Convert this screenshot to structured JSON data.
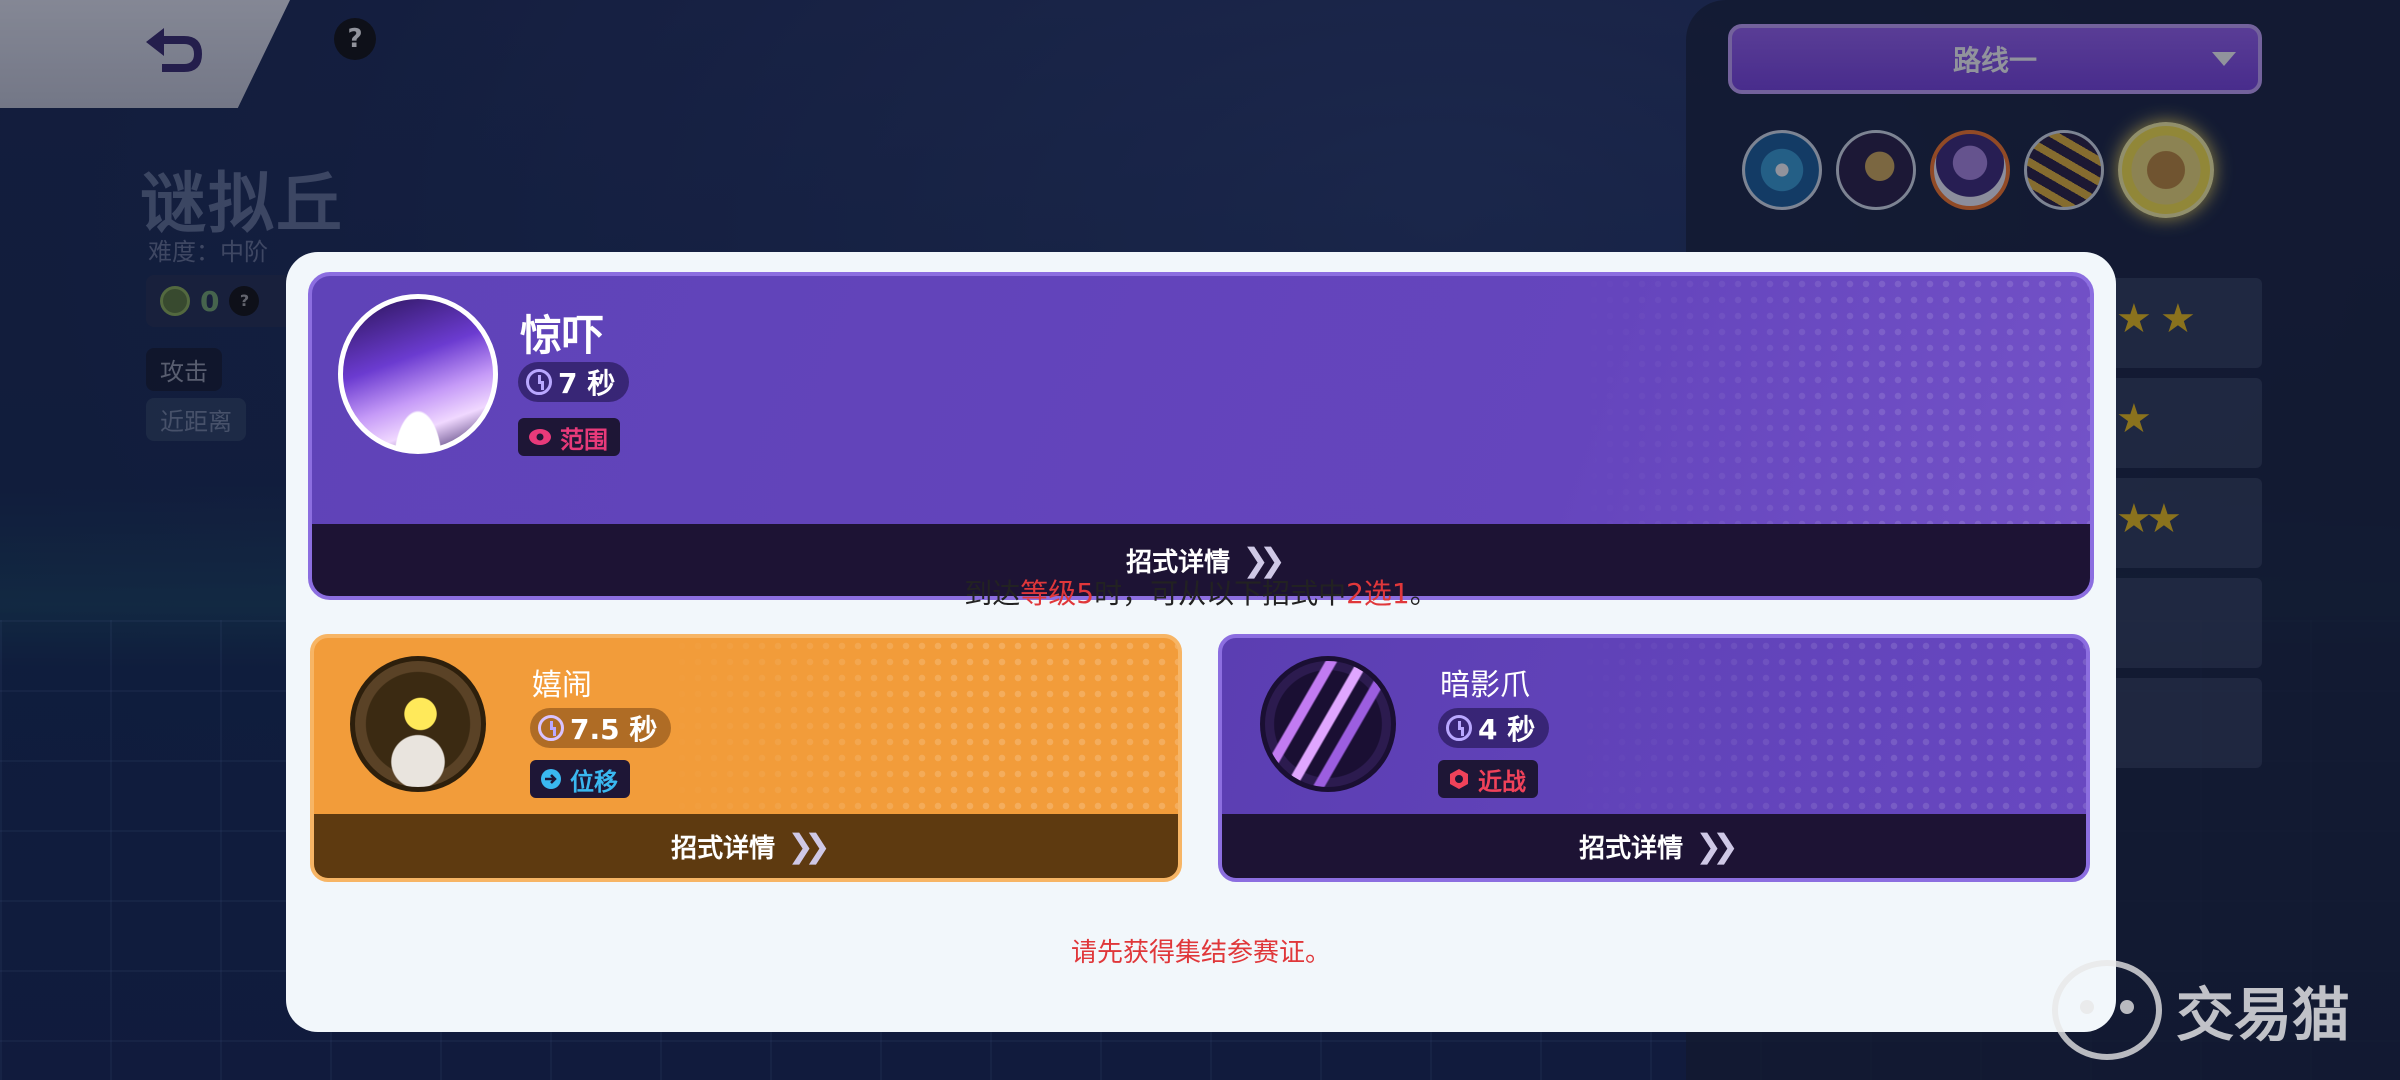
{
  "background": {
    "stage_title": "谜拟丘",
    "difficulty": "难度：中阶",
    "coin_count": "0",
    "help_glyph": "?",
    "tags": [
      "攻击",
      "近距离"
    ]
  },
  "route_selector": {
    "label": "路线一"
  },
  "main_skill": {
    "name": "惊吓",
    "cooldown": "7 秒",
    "type": "范围",
    "type_color": "#e83a7a",
    "detail_label": "招式详情"
  },
  "unlock_text": {
    "prefix": "到达",
    "level": "等级5",
    "middle": "时，可从以下招式中",
    "choice": "2选1",
    "suffix": "。"
  },
  "option_skills": [
    {
      "name": "嬉闹",
      "cooldown": "7.5 秒",
      "type": "位移",
      "type_color": "#3ab8f0",
      "detail_label": "招式详情"
    },
    {
      "name": "暗影爪",
      "cooldown": "4 秒",
      "type": "近战",
      "type_color": "#f0425a",
      "detail_label": "招式详情"
    }
  ],
  "warning": "请先获得集结参赛证。",
  "watermark": "交易猫",
  "colors": {
    "accent_red": "#e0373a",
    "purple": "#6545bd",
    "orange": "#f29c3a"
  }
}
